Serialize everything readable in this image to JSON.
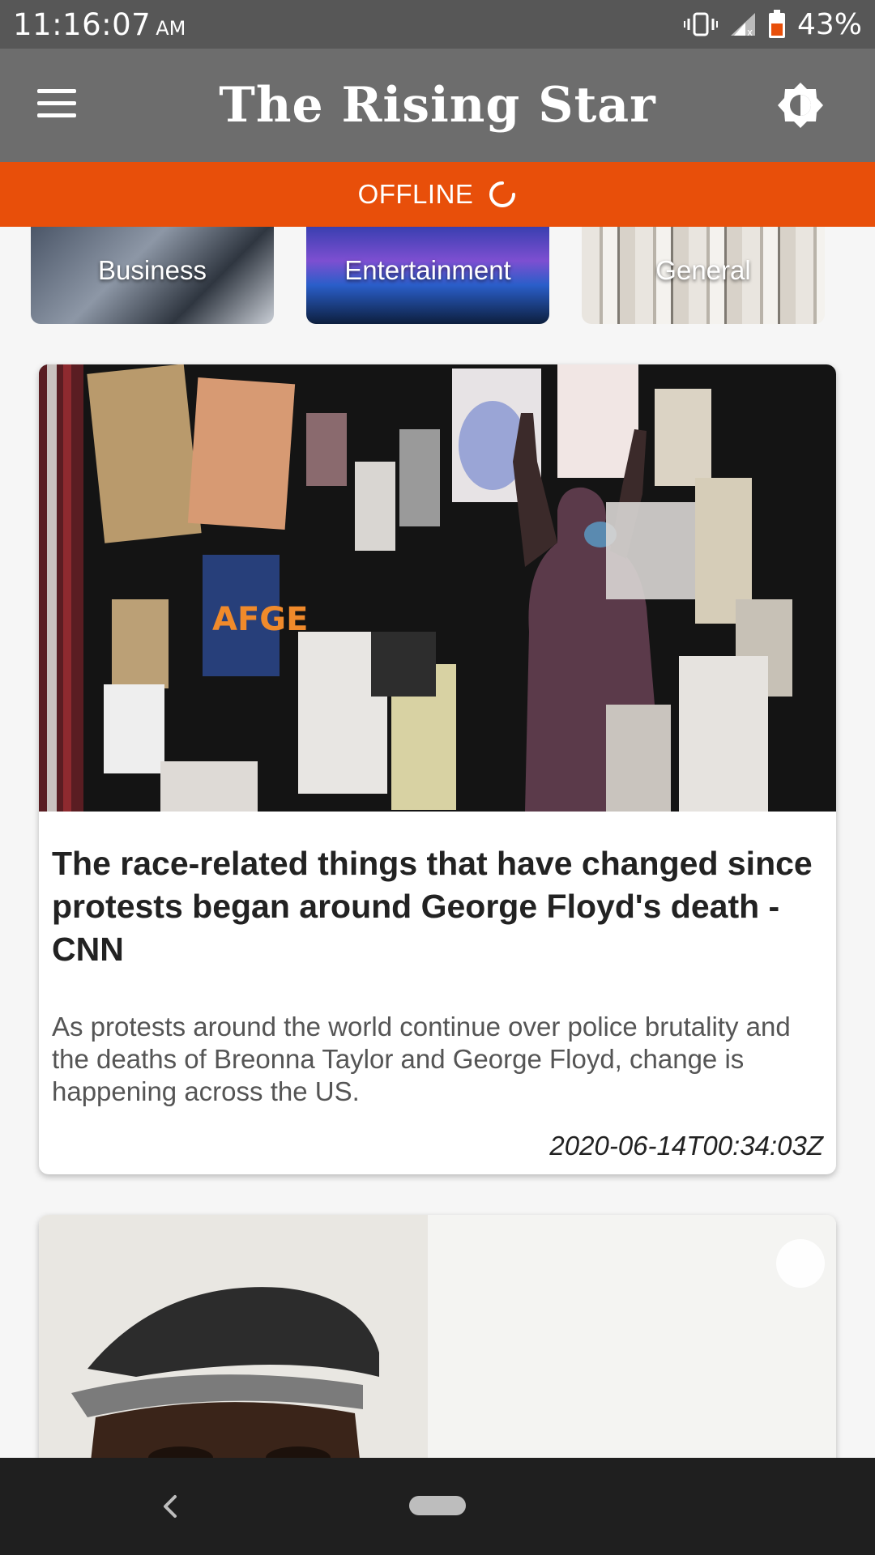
{
  "status_bar": {
    "time": "11:16:07",
    "ampm": "AM",
    "battery": "43%",
    "icons": [
      "vibrate-icon",
      "signal-icon",
      "battery-icon"
    ]
  },
  "app_bar": {
    "title": "The Rising Star",
    "menu_icon": "hamburger-menu-icon",
    "theme_icon": "brightness-icon"
  },
  "offline_banner": {
    "text": "OFFLINE",
    "icon": "loading-spinner-icon",
    "color": "#e84f0a"
  },
  "categories": [
    {
      "label": "Business"
    },
    {
      "label": "Entertainment"
    },
    {
      "label": "General"
    }
  ],
  "articles": [
    {
      "title": "The race-related things that have changed since protests began around George Floyd's death - CNN",
      "description": "As protests around the world continue over police brutality and the deaths of Breonna Taylor and George Floyd, change is happening across the US.",
      "published_at": "2020-06-14T00:34:03Z"
    }
  ],
  "nav_bar": {
    "back_icon": "back-chevron-icon",
    "home_icon": "home-pill-icon"
  },
  "colors": {
    "status_bar": "#575757",
    "app_bar": "#6d6d6d",
    "accent": "#e84f0a",
    "nav_bar": "#1f1f1f"
  }
}
